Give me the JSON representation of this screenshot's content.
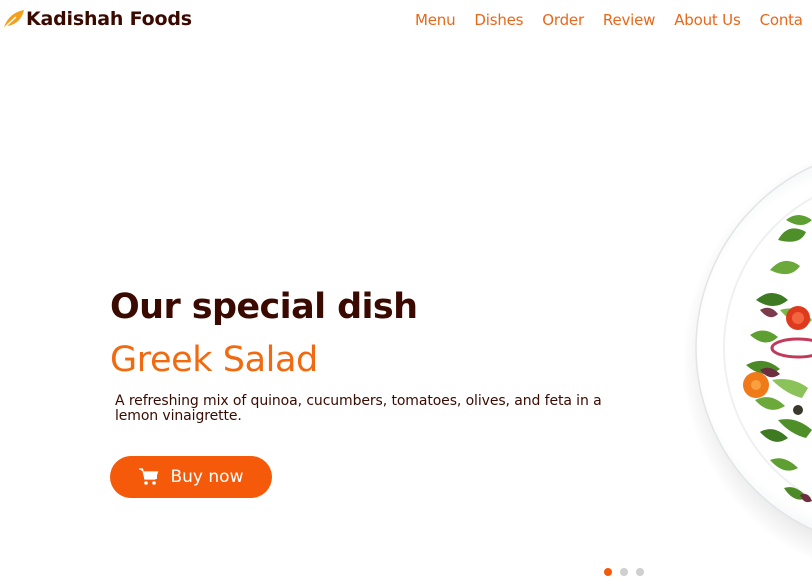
{
  "brand": {
    "name": "Kadishah Foods",
    "icon": "leaf-icon",
    "color": "#3a0a00",
    "icon_color": "#f5a01a"
  },
  "nav": {
    "items": [
      {
        "label": "Menu"
      },
      {
        "label": "Dishes"
      },
      {
        "label": "Order"
      },
      {
        "label": "Review"
      },
      {
        "label": "About Us"
      },
      {
        "label": "Conta"
      }
    ],
    "color": "#e8671a"
  },
  "hero": {
    "title": "Our special dish",
    "dish_name": "Greek Salad",
    "description": "A refreshing mix of quinoa, cucumbers, tomatoes, olives, and feta in a lemon vinaigrette.",
    "button": {
      "label": "Buy now",
      "icon": "shopping-cart-icon",
      "color": "#f55a0a"
    },
    "image": "greek-salad-plate"
  },
  "carousel": {
    "slide_count": 3,
    "active_index": 0,
    "active_color": "#f55a0a",
    "inactive_color": "#cfcfcf"
  }
}
